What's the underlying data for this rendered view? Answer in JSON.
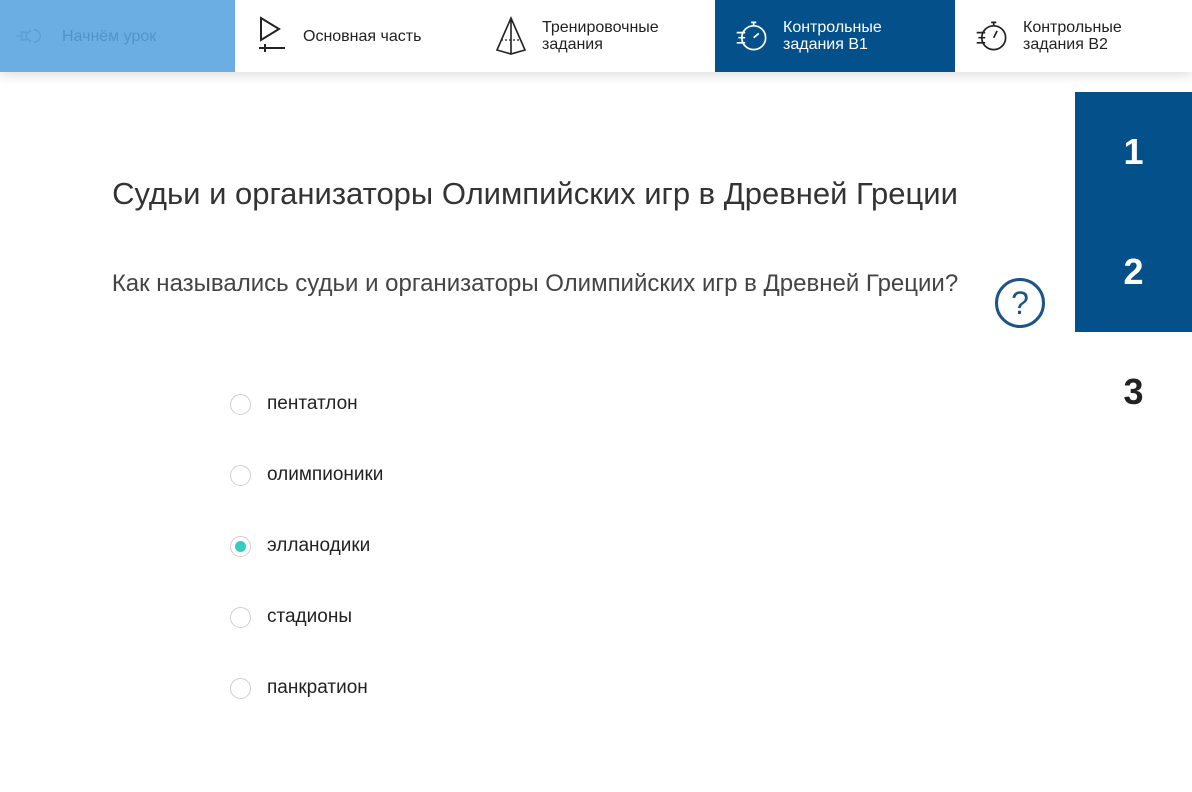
{
  "nav": {
    "tabs": [
      {
        "label": "Начнём урок",
        "icon": "plug-icon"
      },
      {
        "label": "Основная часть",
        "icon": "play-icon"
      },
      {
        "label": "Тренировочные\nзадания",
        "icon": "pyramid-icon"
      },
      {
        "label": "Контрольные\nзадания В1",
        "icon": "stopwatch-icon"
      },
      {
        "label": "Контрольные\nзадания В2",
        "icon": "stopwatch-icon"
      }
    ],
    "active_tab": "Контрольные задания В1"
  },
  "sidebar": {
    "items": [
      {
        "label": "1",
        "state": "active"
      },
      {
        "label": "2",
        "state": "active"
      },
      {
        "label": "3",
        "state": "plain"
      }
    ]
  },
  "task": {
    "title": "Судьи и организаторы Олимпийских игр в Древней Греции",
    "question": "Как назывались судьи и организаторы Олимпийских игр в Древней Греции?",
    "help_label": "?",
    "options": [
      {
        "label": "пентатлон",
        "selected": false
      },
      {
        "label": "олимпионики",
        "selected": false
      },
      {
        "label": "элланодики",
        "selected": true
      },
      {
        "label": "стадионы",
        "selected": false
      },
      {
        "label": "панкратион",
        "selected": false
      }
    ]
  },
  "colors": {
    "accent": "#04508a",
    "start_tab": "#6aaee3",
    "radio_selected": "#34cdbf",
    "help": "#1c5488"
  }
}
